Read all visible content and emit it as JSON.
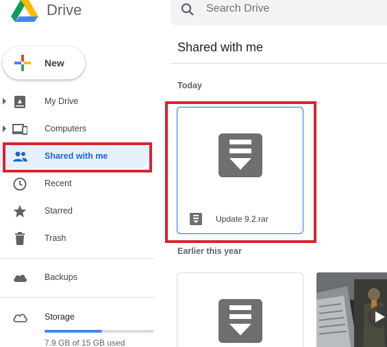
{
  "app": {
    "name": "Drive"
  },
  "new_button": {
    "label": "New"
  },
  "sidebar": {
    "items": [
      {
        "label": "My Drive",
        "icon": "my-drive-icon",
        "expandable": true
      },
      {
        "label": "Computers",
        "icon": "computers-icon",
        "expandable": true
      },
      {
        "label": "Shared with me",
        "icon": "shared-people-icon",
        "active": true
      },
      {
        "label": "Recent",
        "icon": "clock-icon"
      },
      {
        "label": "Starred",
        "icon": "star-icon"
      },
      {
        "label": "Trash",
        "icon": "trash-icon"
      }
    ],
    "backups": {
      "label": "Backups",
      "icon": "cloud-icon"
    },
    "storage": {
      "label": "Storage",
      "icon": "cloud-outline-icon",
      "usage_text": "7.9 GB of 15 GB used",
      "used_fraction": 0.527
    }
  },
  "search": {
    "placeholder": "Search Drive"
  },
  "main": {
    "title": "Shared with me",
    "sections": [
      {
        "label": "Today",
        "files": [
          {
            "name": "Update 9.2.rar",
            "type": "archive",
            "selected": true
          }
        ]
      },
      {
        "label": "Earlier this year",
        "files": [
          {
            "name": "",
            "type": "archive"
          },
          {
            "name": "",
            "type": "video"
          }
        ]
      }
    ]
  },
  "colors": {
    "accent": "#1a73e8",
    "active_bg": "#e8f0fe",
    "highlight": "#d8232f",
    "icon_gray": "#5f6368"
  }
}
